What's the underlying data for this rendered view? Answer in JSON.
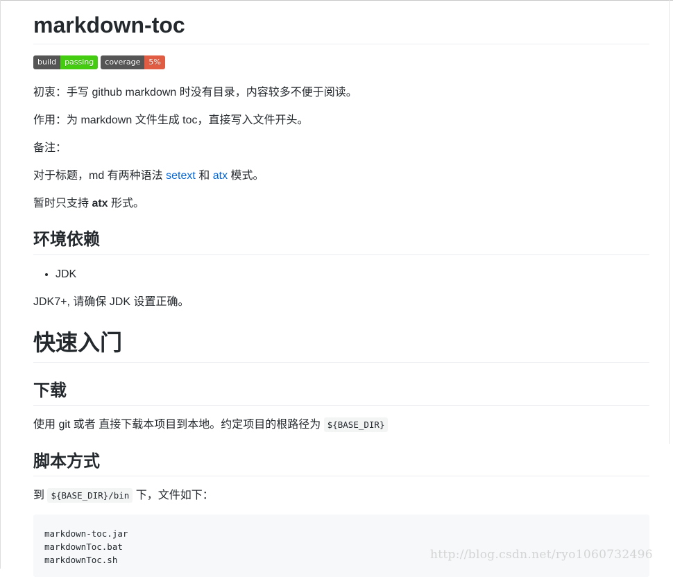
{
  "title": "markdown-toc",
  "badges": [
    {
      "key": "build",
      "value": "passing",
      "color": "#4c1"
    },
    {
      "key": "coverage",
      "value": "5%",
      "color": "#e05d44"
    }
  ],
  "paragraphs": {
    "p1": "初衷：手写 github markdown 时没有目录，内容较多不便于阅读。",
    "p2": "作用：为 markdown 文件生成 toc，直接写入文件开头。",
    "p3": "备注：",
    "p4_a": "对于标题，md 有两种语法 ",
    "p4_link1": "setext",
    "p4_b": " 和 ",
    "p4_link2": "atx",
    "p4_c": " 模式。",
    "p5_a": "暂时只支持 ",
    "p5_strong": "atx",
    "p5_b": " 形式。"
  },
  "env": {
    "heading": "环境依赖",
    "items": [
      "JDK"
    ],
    "note": "JDK7+, 请确保 JDK 设置正确。"
  },
  "quickstart": {
    "heading": "快速入门"
  },
  "download": {
    "heading": "下载",
    "text": "使用 git 或者 直接下载本项目到本地。约定项目的根路径为 ",
    "code": "${BASE_DIR}"
  },
  "script": {
    "heading": "脚本方式",
    "text_a": "到 ",
    "code": "${BASE_DIR}/bin",
    "text_b": " 下，文件如下：",
    "files": "markdown-toc.jar\nmarkdownToc.bat\nmarkdownToc.sh"
  },
  "watermark": "http://blog.csdn.net/ryo1060732496"
}
